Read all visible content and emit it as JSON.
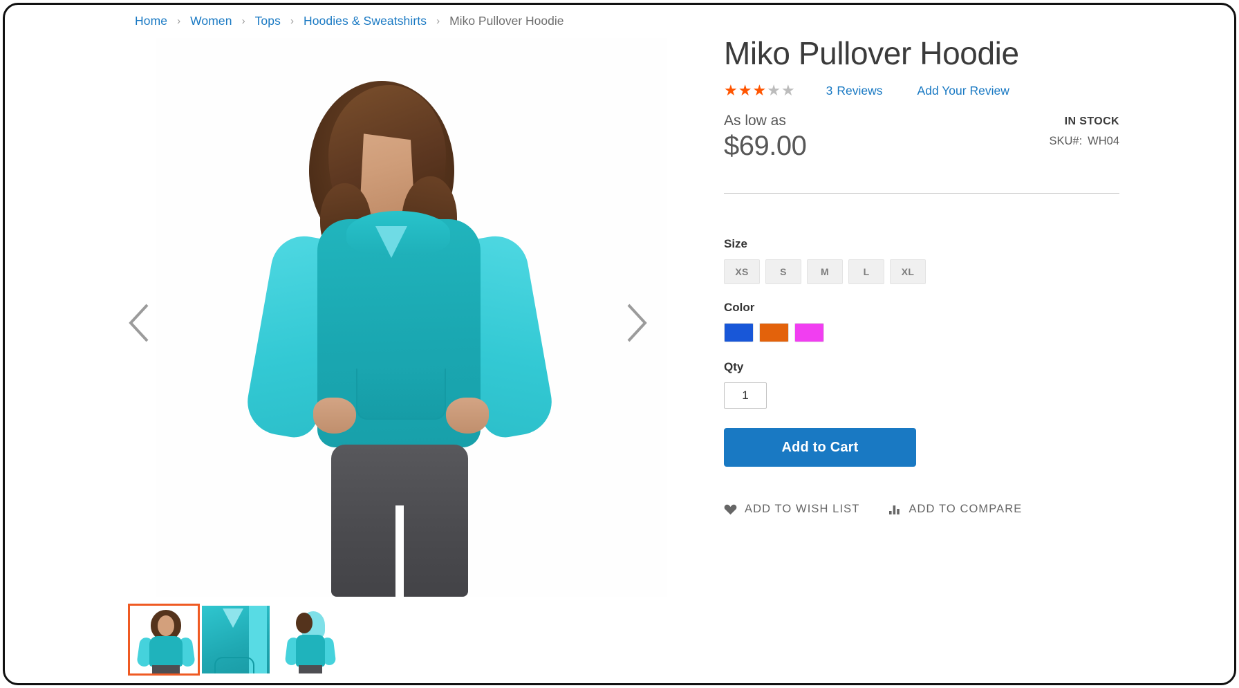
{
  "breadcrumb": {
    "separator": "›",
    "items": [
      {
        "label": "Home",
        "current": false
      },
      {
        "label": "Women",
        "current": false
      },
      {
        "label": "Tops",
        "current": false
      },
      {
        "label": "Hoodies & Sweatshirts",
        "current": false
      },
      {
        "label": "Miko Pullover Hoodie",
        "current": true
      }
    ]
  },
  "gallery": {
    "prev_icon": "chevron-left-icon",
    "next_icon": "chevron-right-icon",
    "thumbnails": [
      {
        "alt": "Model wearing Miko Pullover Hoodie front view",
        "selected": true
      },
      {
        "alt": "Close-up detail of hoodie neckline and sleeve",
        "selected": false
      },
      {
        "alt": "Model wearing Miko Pullover Hoodie back view",
        "selected": false
      }
    ]
  },
  "product": {
    "title": "Miko Pullover Hoodie",
    "rating": {
      "filled": 3,
      "total": 5,
      "star_glyph": "★",
      "filled_color": "#ff5501",
      "empty_color": "#bcbcbc",
      "reviews_count": "3",
      "reviews_label": "Reviews",
      "add_review_label": "Add Your Review"
    },
    "price_label": "As low as",
    "price": "$69.00",
    "stock_status": "IN STOCK",
    "sku_label": "SKU#:",
    "sku_value": "WH04"
  },
  "options": {
    "size": {
      "label": "Size",
      "values": [
        "XS",
        "S",
        "M",
        "L",
        "XL"
      ]
    },
    "color": {
      "label": "Color",
      "values": [
        {
          "name": "Blue",
          "hex": "#1857d8"
        },
        {
          "name": "Orange",
          "hex": "#e3620b"
        },
        {
          "name": "Purple",
          "hex": "#f13ef1"
        }
      ]
    },
    "qty": {
      "label": "Qty",
      "value": "1"
    }
  },
  "actions": {
    "add_to_cart_label": "Add to Cart",
    "add_to_cart_color": "#1979c3",
    "wish_list_label": "ADD TO WISH LIST",
    "wish_list_icon": "heart-icon",
    "compare_label": "ADD TO COMPARE",
    "compare_icon": "bar-chart-icon"
  },
  "theme": {
    "link_color": "#1979c3",
    "accent_orange": "#ef5a23",
    "text_color": "#333333"
  }
}
